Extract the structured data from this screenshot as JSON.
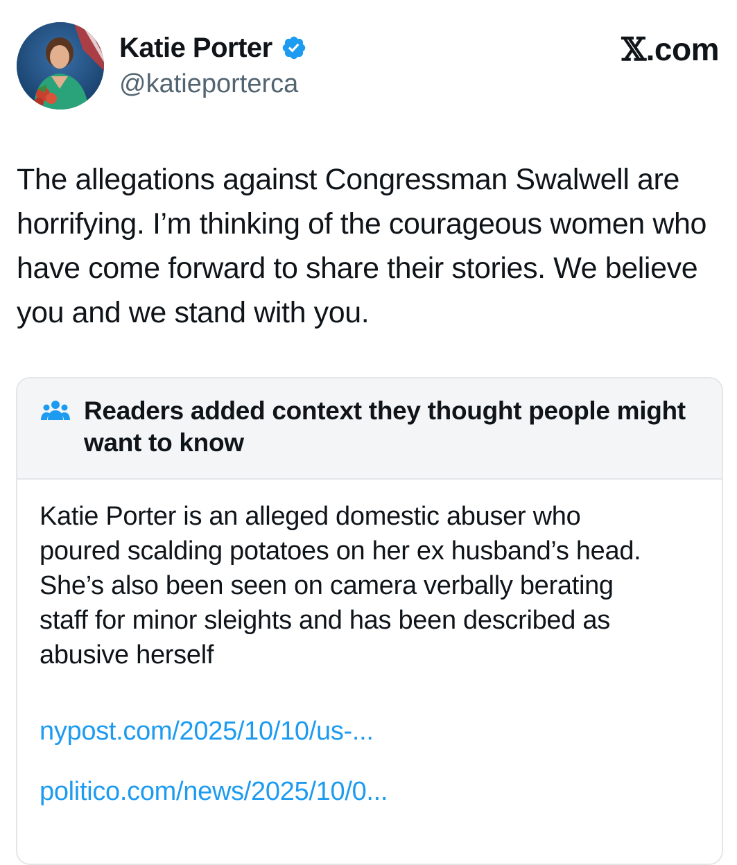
{
  "author": {
    "display_name": "Katie Porter",
    "handle": "@katieporterca",
    "verified": true,
    "verified_color": "#1d9bf0"
  },
  "site_label": {
    "glyph": "𝕏",
    "text": ".com"
  },
  "tweet": {
    "text": "The allegations against Congressman Swalwell are horrifying. I’m thinking of the courageous women who have come forward to share their stories. We believe you and we stand with you."
  },
  "community_note": {
    "icon": "people-icon",
    "title": "Readers added context they thought people might want to know",
    "body": "Katie Porter is an alleged domestic abuser who poured scalding potatoes on her ex husband’s head. She’s also been seen on camera verbally berating staff for minor sleights and has been described as abusive herself",
    "links": [
      "nypost.com/2025/10/10/us-...",
      "politico.com/news/2025/10/0..."
    ],
    "link_color": "#1d9bf0"
  }
}
